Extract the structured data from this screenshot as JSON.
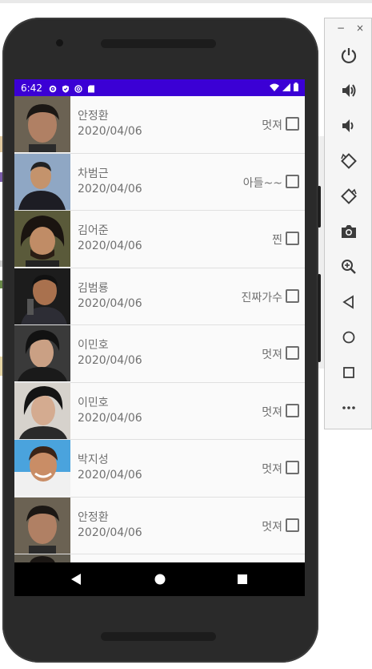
{
  "colors": {
    "status_bar": "#3b00d5",
    "phone_body": "#2a2a2a",
    "screen_bg": "#fafafa",
    "text": "#707070",
    "panel_icon": "#3c3c3c"
  },
  "status_bar": {
    "time": "6:42",
    "left_icons": [
      "gear-icon",
      "shield-icon",
      "at-icon",
      "sd-card-icon"
    ],
    "right_icons": [
      "wifi-icon",
      "signal-icon",
      "battery-icon"
    ]
  },
  "list": {
    "items": [
      {
        "name": "안정환",
        "date": "2020/04/06",
        "tag": "멋져",
        "checked": false
      },
      {
        "name": "차범근",
        "date": "2020/04/06",
        "tag": "아들~~",
        "checked": false
      },
      {
        "name": "김어준",
        "date": "2020/04/06",
        "tag": "찐",
        "checked": false
      },
      {
        "name": "김범룡",
        "date": "2020/04/06",
        "tag": "진짜가수",
        "checked": false
      },
      {
        "name": "이민호",
        "date": "2020/04/06",
        "tag": "멋져",
        "checked": false
      },
      {
        "name": "이민호",
        "date": "2020/04/06",
        "tag": "멋져",
        "checked": false
      },
      {
        "name": "박지성",
        "date": "2020/04/06",
        "tag": "멋져",
        "checked": false
      },
      {
        "name": "안정환",
        "date": "2020/04/06",
        "tag": "멋져",
        "checked": false
      }
    ]
  },
  "nav_bar": {
    "buttons": [
      "back-icon",
      "home-icon",
      "recents-icon"
    ]
  },
  "emulator_panel": {
    "window_controls": {
      "minimize": "−",
      "close": "×"
    },
    "tools": [
      "power-icon",
      "volume-up-icon",
      "volume-down-icon",
      "rotate-left-icon",
      "rotate-right-icon",
      "camera-icon",
      "zoom-icon",
      "back-icon",
      "home-icon",
      "overview-icon",
      "more-icon"
    ]
  }
}
